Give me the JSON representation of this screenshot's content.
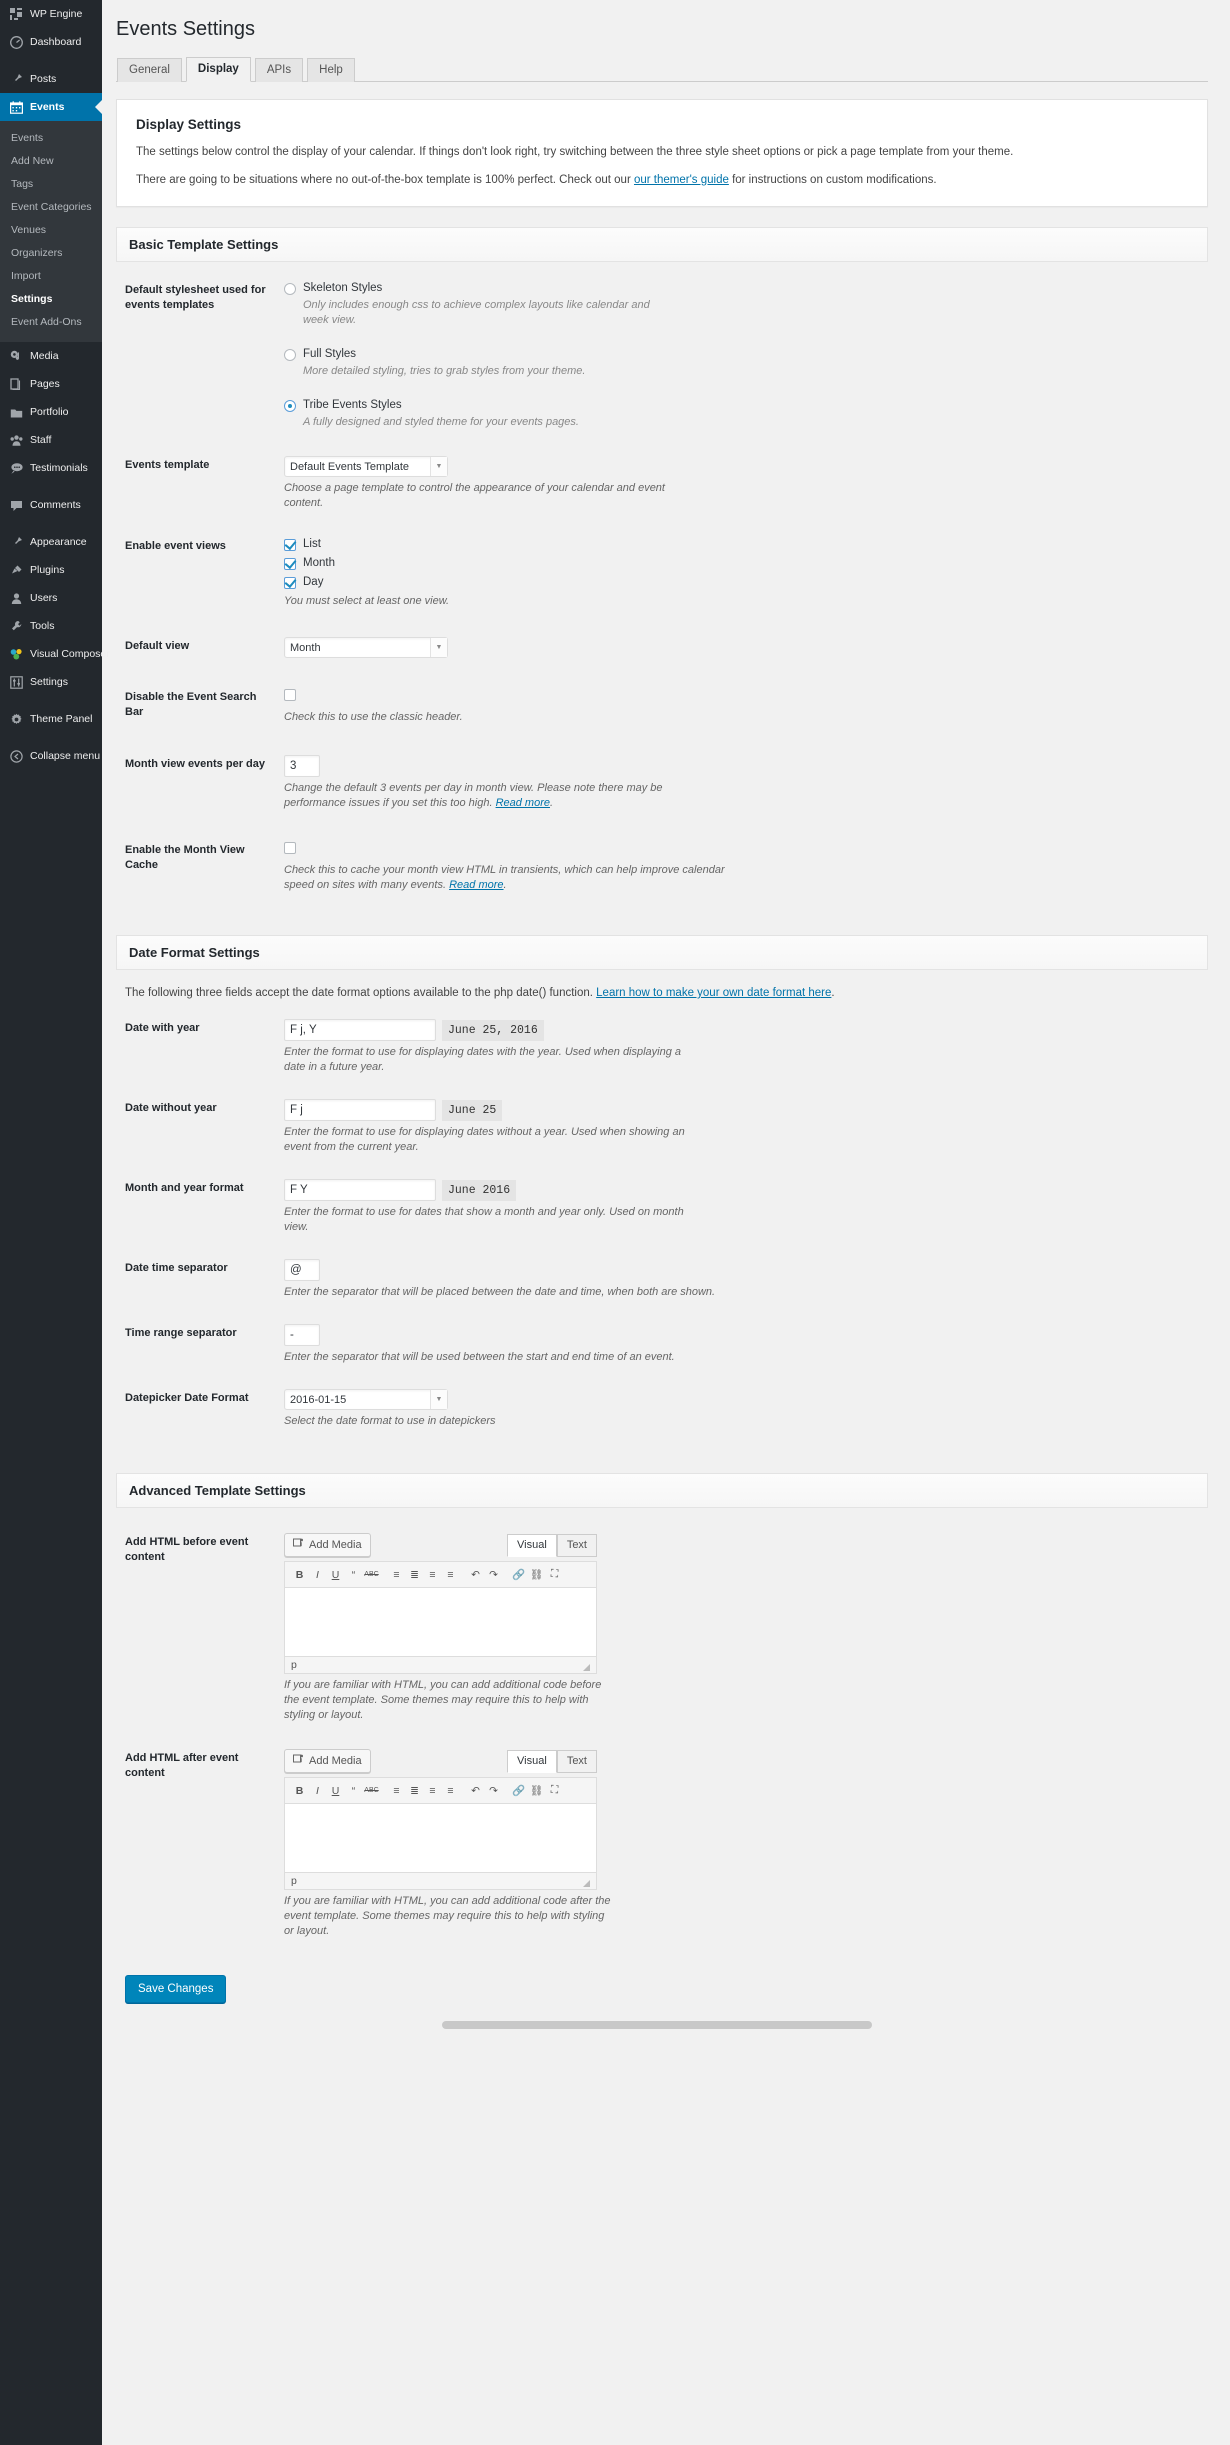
{
  "sidebar": {
    "items": [
      {
        "label": "WP Engine",
        "icon": "wpengine-grid-icon",
        "sep_after": false
      },
      {
        "label": "Dashboard",
        "icon": "dashboard-gauge-icon",
        "sep_after": true
      },
      {
        "label": "Posts",
        "icon": "pin-icon",
        "sep_after": false
      },
      {
        "label": "Events",
        "icon": "calendar-icon",
        "current": true,
        "sep_after": false
      },
      {
        "label": "Media",
        "icon": "media-camera-music-icon",
        "sep_after": false
      },
      {
        "label": "Pages",
        "icon": "page-icon",
        "sep_after": false
      },
      {
        "label": "Portfolio",
        "icon": "portfolio-folder-icon",
        "sep_after": false
      },
      {
        "label": "Staff",
        "icon": "staff-group-icon",
        "sep_after": false
      },
      {
        "label": "Testimonials",
        "icon": "speech-bubble-icon",
        "sep_after": true
      },
      {
        "label": "Comments",
        "icon": "comment-icon",
        "sep_after": true
      },
      {
        "label": "Appearance",
        "icon": "paintbrush-icon",
        "sep_after": false
      },
      {
        "label": "Plugins",
        "icon": "plug-icon",
        "sep_after": false
      },
      {
        "label": "Users",
        "icon": "user-icon",
        "sep_after": false
      },
      {
        "label": "Tools",
        "icon": "wrench-icon",
        "sep_after": false
      },
      {
        "label": "Visual Composer",
        "icon": "visual-composer-icon",
        "sep_after": false
      },
      {
        "label": "Settings",
        "icon": "settings-sliders-icon",
        "sep_after": true
      },
      {
        "label": "Theme Panel",
        "icon": "gear-icon",
        "sep_after": false
      }
    ],
    "submenu": [
      {
        "label": "Events"
      },
      {
        "label": "Add New"
      },
      {
        "label": "Tags"
      },
      {
        "label": "Event Categories"
      },
      {
        "label": "Venues"
      },
      {
        "label": "Organizers"
      },
      {
        "label": "Import"
      },
      {
        "label": "Settings",
        "active": true
      },
      {
        "label": "Event Add-Ons"
      }
    ],
    "collapse": {
      "label": "Collapse menu",
      "icon": "collapse-arrow-icon"
    }
  },
  "header": {
    "title": "Events Settings"
  },
  "tabs": [
    {
      "label": "General",
      "active": false
    },
    {
      "label": "Display",
      "active": true
    },
    {
      "label": "APIs",
      "active": false
    },
    {
      "label": "Help",
      "active": false
    }
  ],
  "info": {
    "heading": "Display Settings",
    "p1": "The settings below control the display of your calendar. If things don't look right, try switching between the three style sheet options or pick a page template from your theme.",
    "p2_before": "There are going to be situations where no out-of-the-box template is 100% perfect. Check out our ",
    "p2_link": "our themer's guide",
    "p2_after": " for instructions on custom modifications."
  },
  "basic": {
    "heading": "Basic Template Settings",
    "stylesheet": {
      "label": "Default stylesheet used for events templates",
      "options": [
        {
          "label": "Skeleton Styles",
          "desc": "Only includes enough css to achieve complex layouts like calendar and week view.",
          "checked": false
        },
        {
          "label": "Full Styles",
          "desc": "More detailed styling, tries to grab styles from your theme.",
          "checked": false
        },
        {
          "label": "Tribe Events Styles",
          "desc": "A fully designed and styled theme for your events pages.",
          "checked": true
        }
      ]
    },
    "events_template": {
      "label": "Events template",
      "value": "Default Events Template",
      "desc": "Choose a page template to control the appearance of your calendar and event content."
    },
    "enable_views": {
      "label": "Enable event views",
      "items": [
        {
          "label": "List",
          "checked": true
        },
        {
          "label": "Month",
          "checked": true
        },
        {
          "label": "Day",
          "checked": true
        }
      ],
      "desc": "You must select at least one view."
    },
    "default_view": {
      "label": "Default view",
      "value": "Month"
    },
    "disable_search": {
      "label": "Disable the Event Search Bar",
      "checked": false,
      "desc": "Check this to use the classic header."
    },
    "events_per_day": {
      "label": "Month view events per day",
      "value": "3",
      "desc_before": "Change the default 3 events per day in month view. Please note there may be performance issues if you set this too high. ",
      "desc_link": "Read more",
      "desc_after": "."
    },
    "month_cache": {
      "label": "Enable the Month View Cache",
      "checked": false,
      "desc_before": "Check this to cache your month view HTML in transients, which can help improve calendar speed on sites with many events. ",
      "desc_link": "Read more",
      "desc_after": "."
    }
  },
  "dates": {
    "heading": "Date Format Settings",
    "intro_before": "The following three fields accept the date format options available to the php date() function. ",
    "intro_link": "Learn how to make your own date format here",
    "intro_after": ".",
    "with_year": {
      "label": "Date with year",
      "value": "F j, Y",
      "preview": "June 25, 2016",
      "desc": "Enter the format to use for displaying dates with the year. Used when displaying a date in a future year."
    },
    "without_year": {
      "label": "Date without year",
      "value": "F j",
      "preview": "June 25",
      "desc": "Enter the format to use for displaying dates without a year. Used when showing an event from the current year."
    },
    "month_year": {
      "label": "Month and year format",
      "value": "F Y",
      "preview": "June 2016",
      "desc": "Enter the format to use for dates that show a month and year only. Used on month view."
    },
    "datetime_sep": {
      "label": "Date time separator",
      "value": "@",
      "desc": "Enter the separator that will be placed between the date and time, when both are shown."
    },
    "time_range_sep": {
      "label": "Time range separator",
      "value": "-",
      "desc": "Enter the separator that will be used between the start and end time of an event."
    },
    "datepicker": {
      "label": "Datepicker Date Format",
      "value": "2016-01-15",
      "desc": "Select the date format to use in datepickers"
    }
  },
  "advanced": {
    "heading": "Advanced Template Settings",
    "editor_toolbar": [
      {
        "icon": "bold-icon",
        "glyph": "B"
      },
      {
        "icon": "italic-icon",
        "glyph": "I"
      },
      {
        "icon": "underline-icon",
        "glyph": "U"
      },
      {
        "icon": "blockquote-icon",
        "glyph": "“"
      },
      {
        "icon": "strikethrough-icon",
        "glyph": "ABC"
      },
      {
        "icon": "bulleted-list-icon",
        "glyph": "≡"
      },
      {
        "icon": "numbered-list-icon",
        "glyph": "≣"
      },
      {
        "icon": "align-left-icon",
        "glyph": "≡"
      },
      {
        "icon": "align-center-icon",
        "glyph": "≡"
      },
      {
        "icon": "undo-icon",
        "glyph": "↶"
      },
      {
        "icon": "redo-icon",
        "glyph": "↷"
      },
      {
        "icon": "insert-link-icon",
        "glyph": "🔗"
      },
      {
        "icon": "unlink-icon",
        "glyph": "⛓"
      },
      {
        "icon": "fullscreen-icon",
        "glyph": "⛶"
      }
    ],
    "before": {
      "label": "Add HTML before event content",
      "add_media": "Add Media",
      "add_media_icon": "add-media-icon",
      "tab_visual": "Visual",
      "tab_text": "Text",
      "value": "",
      "path": "p",
      "desc": "If you are familiar with HTML, you can add additional code before the event template. Some themes may require this to help with styling or layout."
    },
    "after": {
      "label": "Add HTML after event content",
      "add_media": "Add Media",
      "add_media_icon": "add-media-icon",
      "tab_visual": "Visual",
      "tab_text": "Text",
      "value": "",
      "path": "p",
      "desc": "If you are familiar with HTML, you can add additional code after the event template. Some themes may require this to help with styling or layout."
    }
  },
  "footer": {
    "save_label": "Save Changes"
  },
  "colors": {
    "sidebar_bg": "#23282d",
    "submenu_bg": "#32373c",
    "accent": "#0073aa",
    "link": "#0073aa",
    "page_bg": "#f1f1f1",
    "primary_button": "#0085ba",
    "checked": "#1e8cbe"
  }
}
